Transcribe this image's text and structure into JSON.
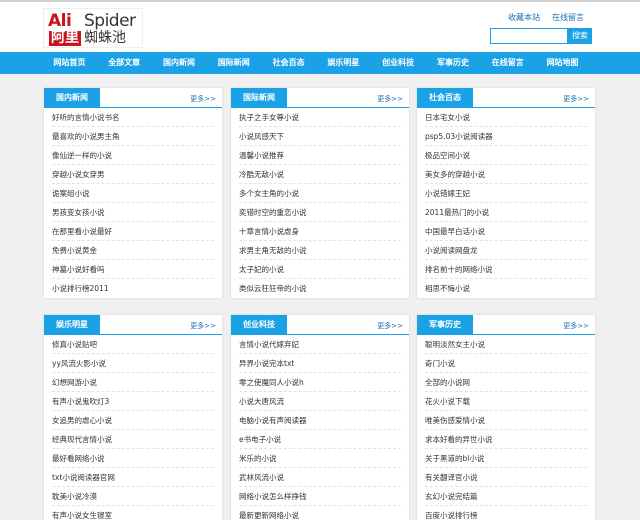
{
  "logo": {
    "ali": "Ali",
    "spider": "Spider",
    "cn_red": "阿里",
    "cn_black": "蜘蛛池"
  },
  "toplinks": {
    "bookmark": "收藏本站",
    "message": "在线留言"
  },
  "search": {
    "placeholder": "",
    "button": "搜索"
  },
  "nav": [
    "网站首页",
    "全部文章",
    "国内新闻",
    "国际新闻",
    "社会百态",
    "娱乐明星",
    "创业科技",
    "军事历史",
    "在线留言",
    "网站地图"
  ],
  "more_label": "更多>>",
  "panels": [
    {
      "title": "国内新闻",
      "items": [
        "好听的言情小说书名",
        "最喜欢的小说男主角",
        "像仙逆一样的小说",
        "穿越小说女穿男",
        "诡案组小说",
        "男孩变女孩小说",
        "在那里看小说最好",
        "免费小说黄金",
        "神墓小说好看吗",
        "小说排行榜2011"
      ]
    },
    {
      "title": "国际新闻",
      "items": [
        "执子之手女尊小说",
        "小说风感天下",
        "温馨小说推荐",
        "冷酷无敌小说",
        "多个女主角的小说",
        "奕错时空的重恋小说",
        "十章言情小说虐身",
        "求男主角无敌的小说",
        "太子妃的小说",
        "类似云狂狂帝的小说"
      ]
    },
    {
      "title": "社会百态",
      "items": [
        "日本宅女小说",
        "psp5.03小说阅读器",
        "极品空间小说",
        "美女多的穿越小说",
        "小说错嫁王妃",
        "2011最热门的小说",
        "中国最早白话小说",
        "小说阅读网盘龙",
        "排名前十的网络小说",
        "相思不悔小说"
      ]
    },
    {
      "title": "娱乐明星",
      "items": [
        "修真小说贴吧",
        "yy风流火影小说",
        "幻想网游小说",
        "有声小说鬼吹灯3",
        "女追男的虐心小说",
        "经典现代言情小说",
        "最好看网络小说",
        "txt小说阅读器官网",
        "耽美小说冷漠",
        "有声小说女生寝室"
      ]
    },
    {
      "title": "创业科技",
      "items": [
        "言情小说代嫁弃妃",
        "异界小说完本txt",
        "零之使魔同人小说h",
        "小说大唐风流",
        "电脑小说有声阅读器",
        "e书电子小说",
        "米乐的小说",
        "武林风流小说",
        "网络小说怎么样挣钱",
        "最新更新网络小说"
      ]
    },
    {
      "title": "军事历史",
      "items": [
        "聪明淡然女主小说",
        "奇门小说",
        "全部的小说网",
        "花火小说下载",
        "唯美伤感爱情小说",
        "求本好看的异世小说",
        "关于黑道的bl小说",
        "有关翻译官小说",
        "玄幻小说完结篇",
        "百度小说排行榜"
      ]
    }
  ]
}
